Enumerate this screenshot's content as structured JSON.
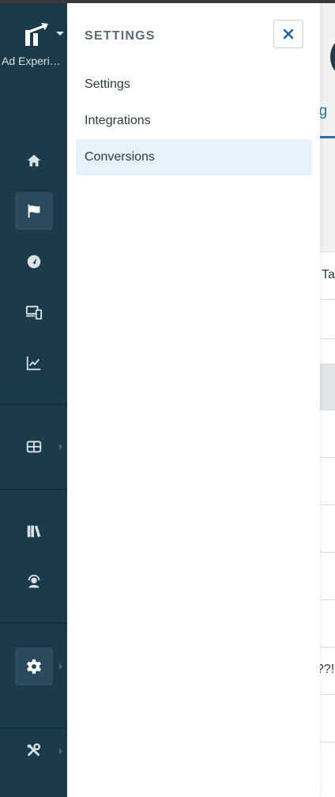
{
  "app": {
    "name": "Ad Experienc...",
    "brand_color": "#1c3a4a"
  },
  "rail": {
    "items": [
      {
        "name": "home-icon",
        "active": false
      },
      {
        "name": "flag-icon",
        "active": true
      },
      {
        "name": "gauge-icon",
        "active": false
      },
      {
        "name": "devices-icon",
        "active": false
      },
      {
        "name": "chart-line-icon",
        "active": false
      },
      {
        "name": "table-icon",
        "active": false,
        "has_submenu": true
      },
      {
        "name": "books-icon",
        "active": false
      },
      {
        "name": "support-agent-icon",
        "active": false
      },
      {
        "name": "gear-icon",
        "active": true,
        "has_submenu": true
      },
      {
        "name": "tools-icon",
        "active": false,
        "has_submenu": true
      }
    ]
  },
  "settings_panel": {
    "title": "SETTINGS",
    "close_icon": "close-icon",
    "items": [
      {
        "label": "Settings",
        "active": false
      },
      {
        "label": "Integrations",
        "active": false
      },
      {
        "label": "Conversions",
        "active": true
      }
    ],
    "active_color": "#e6f2fb"
  },
  "background_page": {
    "tab_text": "ng",
    "column_text": "Ta",
    "cell_text": "??!"
  }
}
